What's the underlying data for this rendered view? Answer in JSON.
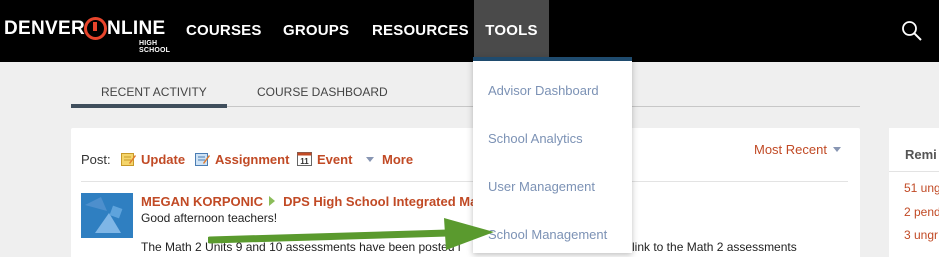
{
  "header": {
    "logo": {
      "word_left": "DENVER",
      "word_right": "NLINE",
      "subtitle": "HIGH SCHOOL"
    },
    "nav": [
      {
        "label": "COURSES"
      },
      {
        "label": "GROUPS"
      },
      {
        "label": "RESOURCES"
      },
      {
        "label": "TOOLS",
        "active": true
      }
    ],
    "search_icon": "search-icon"
  },
  "tools_menu": {
    "items": [
      {
        "label": "Advisor Dashboard"
      },
      {
        "label": "School Analytics"
      },
      {
        "label": "User Management"
      },
      {
        "label": "School Management"
      }
    ],
    "accent": "#1f4b6e"
  },
  "tabs": [
    {
      "label": "RECENT ACTIVITY",
      "active": true
    },
    {
      "label": "COURSE DASHBOARD"
    }
  ],
  "post_bar": {
    "label": "Post:",
    "options": [
      {
        "label": "Update",
        "icon": "pencil-note-icon"
      },
      {
        "label": "Assignment",
        "icon": "assignment-icon"
      },
      {
        "label": "Event",
        "icon": "calendar-icon",
        "icon_text": "11"
      },
      {
        "label": "More",
        "icon": "caret-down-icon"
      }
    ],
    "sort_label": "Most Recent"
  },
  "feed": {
    "items": [
      {
        "author": "MEGAN KORPONIC",
        "target": "DPS High School Integrated Ma",
        "greeting": "Good afternoon teachers!",
        "body_left": "The Math 2 Units 9 and 10 assessments have been posted i",
        "body_right": "link to the Math 2 assessments"
      }
    ]
  },
  "sidebar": {
    "title": "Remi",
    "links": [
      {
        "label": "51 ungr"
      },
      {
        "label": "2 pend"
      },
      {
        "label": "3 ungr"
      }
    ]
  },
  "colors": {
    "link_orange": "#c14a25",
    "menu_text": "#7c92b5",
    "annotation_green": "#5a9a2e"
  }
}
